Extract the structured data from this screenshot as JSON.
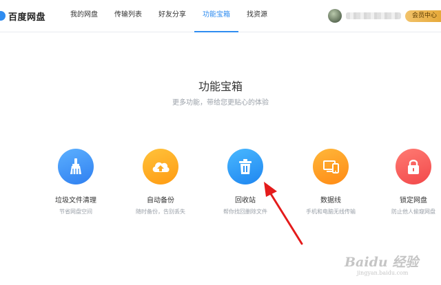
{
  "brand": {
    "name": "百度网盘"
  },
  "nav": {
    "items": [
      {
        "label": "我的网盘",
        "active": false
      },
      {
        "label": "传输列表",
        "active": false
      },
      {
        "label": "好友分享",
        "active": false
      },
      {
        "label": "功能宝箱",
        "active": true
      },
      {
        "label": "找资源",
        "active": false
      }
    ]
  },
  "user": {
    "member_label": "会员中心"
  },
  "page": {
    "title": "功能宝箱",
    "subtitle": "更多功能，带给您更贴心的体验"
  },
  "tools": [
    {
      "name": "垃圾文件清理",
      "desc": "节省网盘空间",
      "icon": "broom-icon",
      "color_from": "#5cb0ff",
      "color_to": "#2f7ff0"
    },
    {
      "name": "自动备份",
      "desc": "随时备份，告别丢失",
      "icon": "cloud-upload-icon",
      "color_from": "#ffc23b",
      "color_to": "#ff9b12"
    },
    {
      "name": "回收站",
      "desc": "帮你找回删除文件",
      "icon": "trash-icon",
      "color_from": "#49b8ff",
      "color_to": "#1f86f0"
    },
    {
      "name": "数据线",
      "desc": "手机和电脑无线传输",
      "icon": "devices-icon",
      "color_from": "#ffb73a",
      "color_to": "#ff8a14"
    },
    {
      "name": "锁定网盘",
      "desc": "防止他人偷窥网盘",
      "icon": "lock-icon",
      "color_from": "#ff7b73",
      "color_to": "#f2484a"
    }
  ],
  "watermark": {
    "main": "Baidu 经验",
    "sub": "jingyan.baidu.com"
  },
  "colors": {
    "accent": "#2f8cf0",
    "annotation": "#e41b1b"
  }
}
